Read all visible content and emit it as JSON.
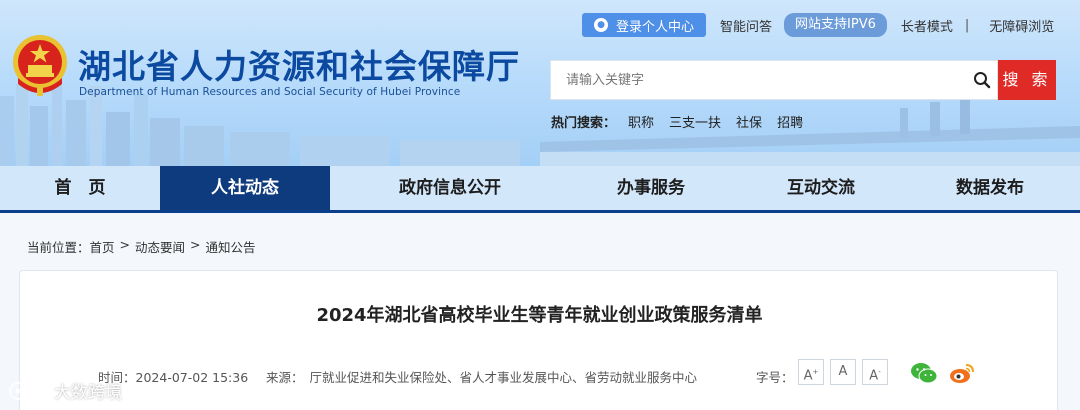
{
  "header": {
    "title_cn": "湖北省人力资源和社会保障厅",
    "title_en": "Department of Human Resources and Social Security of Hubei Province",
    "login_label": "登录个人中心",
    "qa_label": "智能问答",
    "ipv6_label": "网站支持IPV6",
    "elder_label": "长者模式",
    "separator": "|",
    "accessible_label": "无障碍浏览"
  },
  "search": {
    "placeholder": "请输入关键字",
    "button_label": "搜 索"
  },
  "hot_search": {
    "label": "热门搜索：",
    "items": [
      "职称",
      "三支一扶",
      "社保",
      "招聘"
    ]
  },
  "nav": {
    "items": [
      "首　页",
      "人社动态",
      "政府信息公开",
      "办事服务",
      "互动交流",
      "数据发布"
    ],
    "active_index": 1
  },
  "breadcrumb": {
    "label": "当前位置：",
    "items": [
      "首页",
      "动态要闻",
      "通知公告"
    ],
    "separator": ">"
  },
  "article": {
    "title": "2024年湖北省高校毕业生等青年就业创业政策服务清单",
    "time_label": "时间：",
    "time_value": "2024-07-02 15:36",
    "source_label": "来源：",
    "source_value": "厅就业促进和失业保险处、省人才事业发展中心、省劳动就业服务中心",
    "font_size_label": "字号：",
    "font_buttons": [
      "A",
      "A",
      "A"
    ]
  },
  "watermark": {
    "text": "大数跨境"
  },
  "colors": {
    "brand_blue": "#0b4aa0",
    "nav_active": "#0e3a7e",
    "search_red": "#e02a26",
    "wechat_green": "#3fb43a",
    "weibo_orange": "#f0701b"
  }
}
